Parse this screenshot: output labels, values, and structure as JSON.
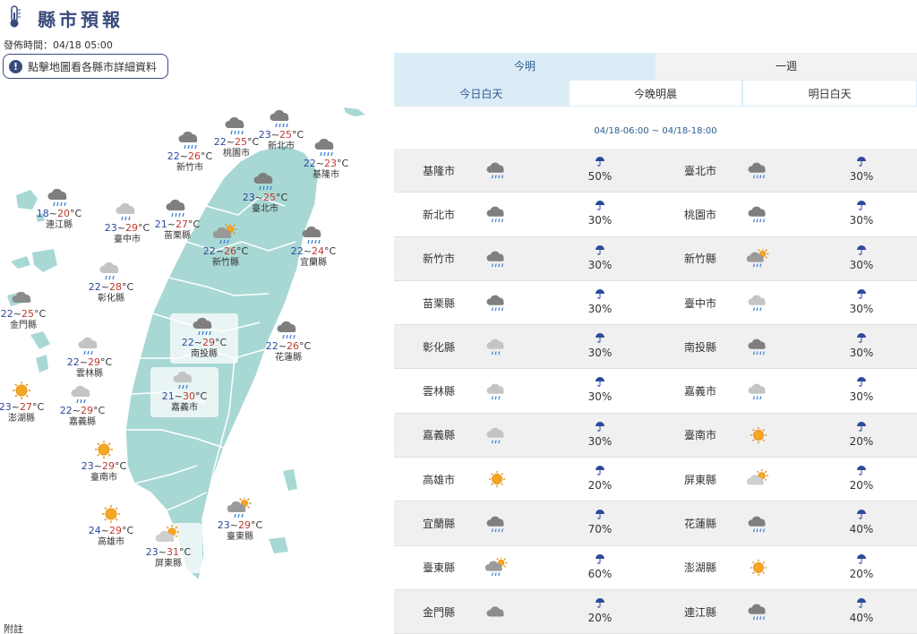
{
  "header": {
    "title": "縣市預報",
    "published": "發佈時間：04/18 05:00",
    "notice": "點擊地圖看各縣市詳細資料",
    "footnote": "附註"
  },
  "tabs": {
    "range": [
      "今明",
      "一週"
    ],
    "period": [
      "今日白天",
      "今晚明晨",
      "明日白天"
    ],
    "time_range": "04/18-06:00 ~ 04/18-18:00"
  },
  "map": [
    {
      "name": "新竹市",
      "lo": "22",
      "hi": "26",
      "icon": "cloud-rain"
    },
    {
      "name": "桃園市",
      "lo": "22",
      "hi": "25",
      "icon": "cloud-rain"
    },
    {
      "name": "新北市",
      "lo": "23",
      "hi": "25",
      "icon": "cloud-rain"
    },
    {
      "name": "基隆市",
      "lo": "22",
      "hi": "23",
      "icon": "cloud-rain"
    },
    {
      "name": "臺北市",
      "lo": "23",
      "hi": "25",
      "icon": "cloud-rain"
    },
    {
      "name": "連江縣",
      "lo": "18",
      "hi": "20",
      "icon": "cloud-rain"
    },
    {
      "name": "臺中市",
      "lo": "23",
      "hi": "29",
      "icon": "cloud-light-rain"
    },
    {
      "name": "苗栗縣",
      "lo": "21",
      "hi": "27",
      "icon": "cloud-rain"
    },
    {
      "name": "新竹縣",
      "lo": "22",
      "hi": "26",
      "icon": "sun-cloud-rain"
    },
    {
      "name": "宜蘭縣",
      "lo": "22",
      "hi": "24",
      "icon": "cloud-rain"
    },
    {
      "name": "彰化縣",
      "lo": "22",
      "hi": "28",
      "icon": "cloud-light-rain"
    },
    {
      "name": "金門縣",
      "lo": "22",
      "hi": "25",
      "icon": "cloud"
    },
    {
      "name": "南投縣",
      "lo": "22",
      "hi": "29",
      "icon": "cloud-rain"
    },
    {
      "name": "花蓮縣",
      "lo": "22",
      "hi": "26",
      "icon": "cloud-rain"
    },
    {
      "name": "雲林縣",
      "lo": "22",
      "hi": "29",
      "icon": "cloud-light-rain"
    },
    {
      "name": "澎湖縣",
      "lo": "23",
      "hi": "27",
      "icon": "sun"
    },
    {
      "name": "嘉義市",
      "lo": "21",
      "hi": "30",
      "icon": "cloud-light-rain"
    },
    {
      "name": "嘉義縣",
      "lo": "22",
      "hi": "29",
      "icon": "cloud-light-rain"
    },
    {
      "name": "臺南市",
      "lo": "23",
      "hi": "29",
      "icon": "sun"
    },
    {
      "name": "高雄市",
      "lo": "24",
      "hi": "29",
      "icon": "sun"
    },
    {
      "name": "屏東縣",
      "lo": "23",
      "hi": "31",
      "icon": "sun-cloud"
    },
    {
      "name": "臺東縣",
      "lo": "23",
      "hi": "29",
      "icon": "sun-cloud-rain"
    }
  ],
  "table": [
    [
      {
        "name": "基隆市",
        "icon": "cloud-rain",
        "pop": "50%"
      },
      {
        "name": "臺北市",
        "icon": "cloud-rain",
        "pop": "30%"
      }
    ],
    [
      {
        "name": "新北市",
        "icon": "cloud-rain",
        "pop": "30%"
      },
      {
        "name": "桃園市",
        "icon": "cloud-rain",
        "pop": "30%"
      }
    ],
    [
      {
        "name": "新竹市",
        "icon": "cloud-rain",
        "pop": "30%"
      },
      {
        "name": "新竹縣",
        "icon": "sun-cloud-rain",
        "pop": "30%"
      }
    ],
    [
      {
        "name": "苗栗縣",
        "icon": "cloud-rain",
        "pop": "30%"
      },
      {
        "name": "臺中市",
        "icon": "cloud-light-rain",
        "pop": "30%"
      }
    ],
    [
      {
        "name": "彰化縣",
        "icon": "cloud-light-rain",
        "pop": "30%"
      },
      {
        "name": "南投縣",
        "icon": "cloud-rain",
        "pop": "30%"
      }
    ],
    [
      {
        "name": "雲林縣",
        "icon": "cloud-light-rain",
        "pop": "30%"
      },
      {
        "name": "嘉義市",
        "icon": "cloud-light-rain",
        "pop": "30%"
      }
    ],
    [
      {
        "name": "嘉義縣",
        "icon": "cloud-light-rain",
        "pop": "30%"
      },
      {
        "name": "臺南市",
        "icon": "sun",
        "pop": "20%"
      }
    ],
    [
      {
        "name": "高雄市",
        "icon": "sun",
        "pop": "20%"
      },
      {
        "name": "屏東縣",
        "icon": "sun-cloud",
        "pop": "20%"
      }
    ],
    [
      {
        "name": "宜蘭縣",
        "icon": "cloud-rain",
        "pop": "70%"
      },
      {
        "name": "花蓮縣",
        "icon": "cloud-rain",
        "pop": "40%"
      }
    ],
    [
      {
        "name": "臺東縣",
        "icon": "sun-cloud-rain",
        "pop": "60%"
      },
      {
        "name": "澎湖縣",
        "icon": "sun",
        "pop": "20%"
      }
    ],
    [
      {
        "name": "金門縣",
        "icon": "cloud",
        "pop": "20%"
      },
      {
        "name": "連江縣",
        "icon": "cloud-rain",
        "pop": "40%"
      }
    ]
  ],
  "colors": {
    "accent": "#3a4a7c",
    "land": "#a8d8d4",
    "low_temp": "#2c4a9c",
    "high_temp": "#c0392b",
    "tab_active": "#dcecf7"
  }
}
